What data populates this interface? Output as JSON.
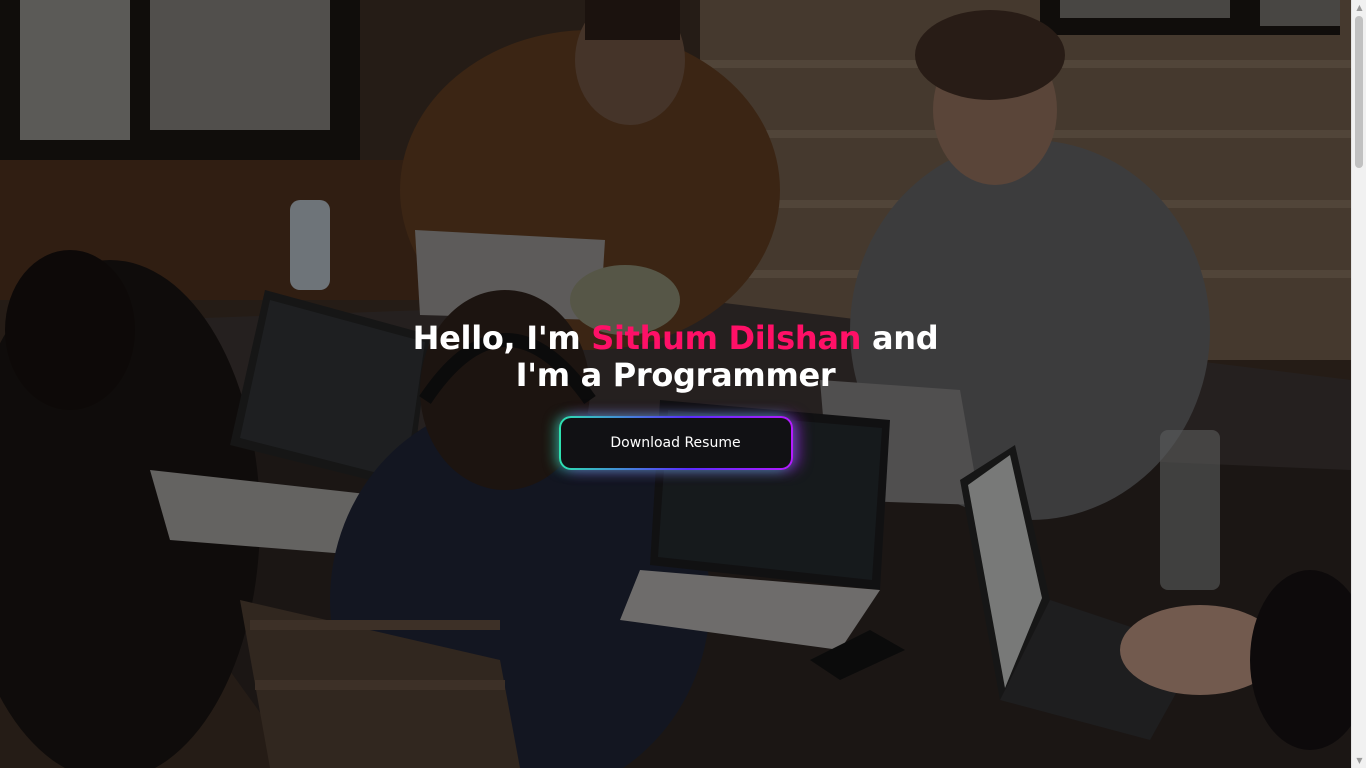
{
  "hero": {
    "background_image": "team-coding-at-table-photo",
    "title_line1_prefix": "Hello, I'm ",
    "title_name": "Sithum Dilshan",
    "title_line1_suffix": " and",
    "title_line2": "I'm a Programmer",
    "download_button_label": "Download Resume"
  },
  "colors": {
    "name_highlight": "#ff1067",
    "button_background": "#111114",
    "button_border_start": "#2de3b0",
    "button_border_end": "#b51bff",
    "title_text": "#ffffff"
  },
  "scrollbar": {
    "up_icon": "triangle-up-icon",
    "down_icon": "triangle-down-icon"
  }
}
